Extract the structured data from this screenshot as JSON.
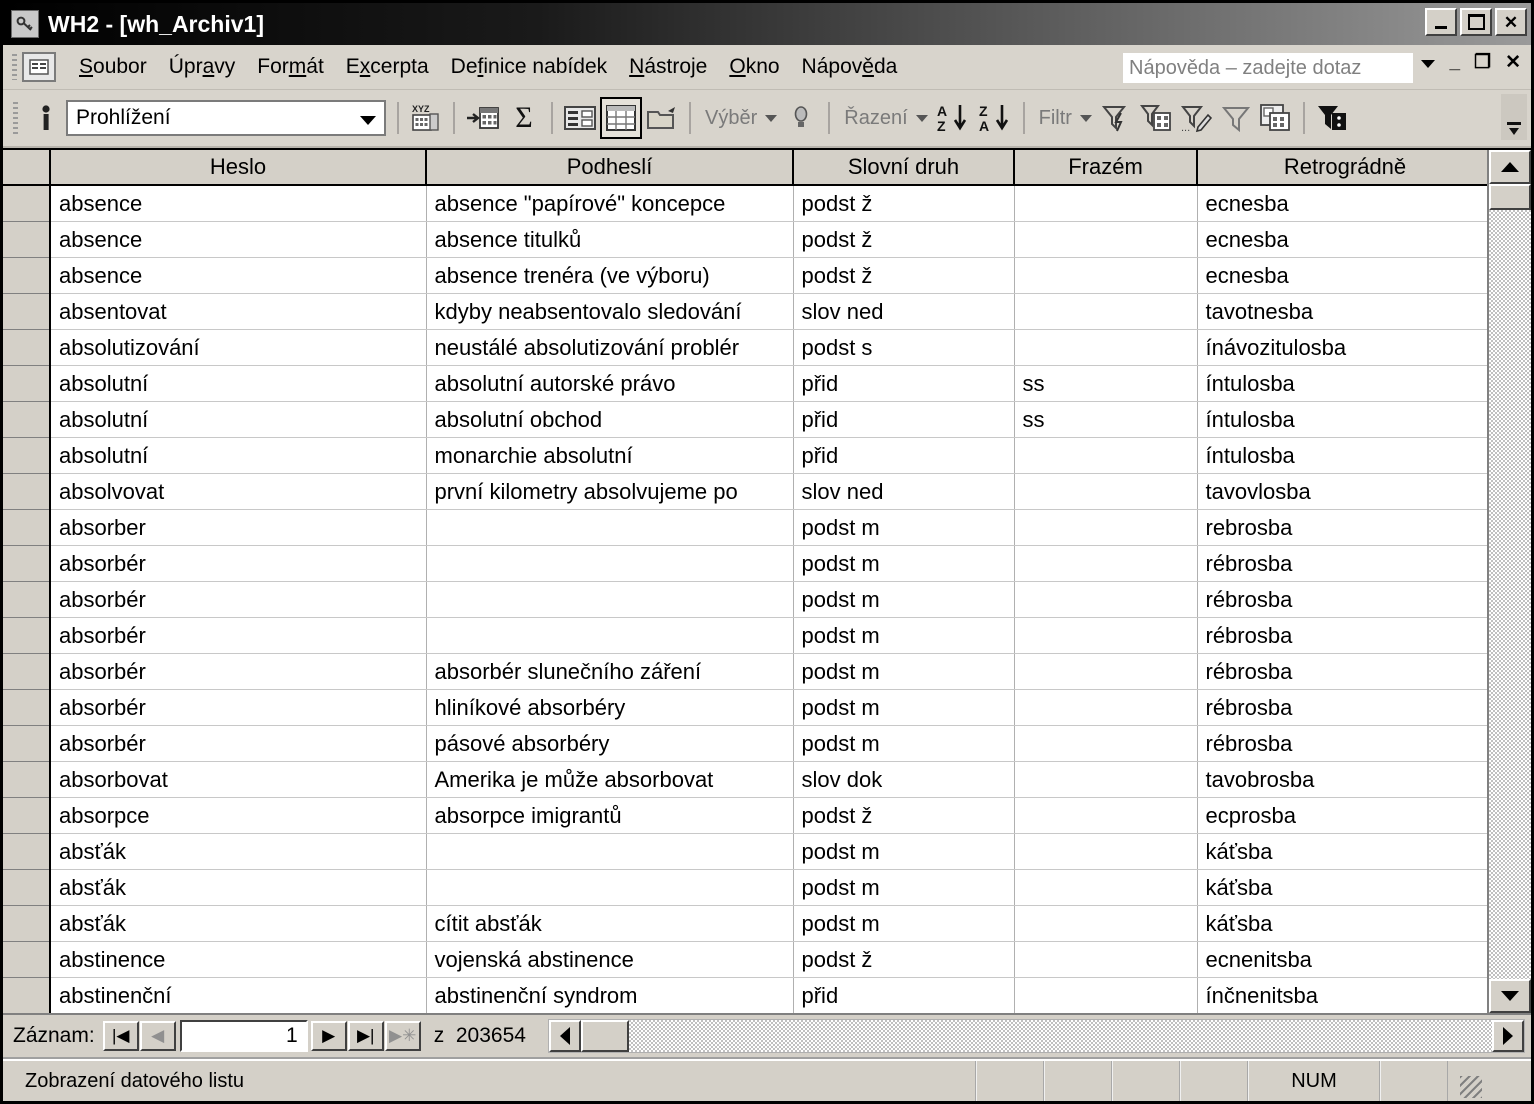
{
  "window": {
    "title": "WH2 - [wh_Archiv1]",
    "icon": "database-window-icon",
    "buttons": {
      "minimize": "_",
      "maximize": "□",
      "close": "✕"
    }
  },
  "menubar": {
    "app_icon": "access-object-icon",
    "items": [
      {
        "label": "Soubor",
        "accel": "S"
      },
      {
        "label": "Úpravy",
        "accel": "a"
      },
      {
        "label": "Formát",
        "accel": "m"
      },
      {
        "label": "Excerpta",
        "accel": "c"
      },
      {
        "label": "Definice nabídek",
        "accel": "f"
      },
      {
        "label": "Nástroje",
        "accel": "N"
      },
      {
        "label": "Okno",
        "accel": "O"
      },
      {
        "label": "Nápověda",
        "accel": "ě"
      }
    ],
    "help_box_placeholder": "Nápověda – zadejte dotaz",
    "mdi_buttons": {
      "minimize": "_",
      "restore": "❐",
      "close": "✕"
    }
  },
  "toolbar": {
    "view_combo_value": "Prohlížení",
    "buttons": [
      {
        "name": "view-person-icon",
        "label": ""
      },
      {
        "name": "spelling-icon",
        "label": "XYZ"
      },
      {
        "name": "new-record-icon",
        "label": ""
      },
      {
        "name": "totals-icon",
        "label": "Σ"
      },
      {
        "name": "form-view-icon",
        "label": ""
      },
      {
        "name": "datasheet-view-icon",
        "label": ""
      },
      {
        "name": "new-object-icon",
        "label": ""
      },
      {
        "name": "selection-label",
        "label": "Výběr"
      },
      {
        "name": "lightbulb-icon",
        "label": ""
      },
      {
        "name": "sort-label",
        "label": "Řazení"
      },
      {
        "name": "sort-ascending-icon",
        "label": "A Z"
      },
      {
        "name": "sort-descending-icon",
        "label": "Z A"
      },
      {
        "name": "filter-label",
        "label": "Filtr"
      },
      {
        "name": "apply-filter-icon",
        "label": ""
      },
      {
        "name": "filter-by-form-icon",
        "label": ""
      },
      {
        "name": "edit-filter-icon",
        "label": ""
      },
      {
        "name": "remove-filter-icon",
        "label": ""
      },
      {
        "name": "advanced-filter-icon",
        "label": ""
      },
      {
        "name": "filter-black-icon",
        "label": ""
      }
    ],
    "overflow_label": "toolbar-overflow-icon"
  },
  "datasheet": {
    "columns": [
      "Heslo",
      "Podheslí",
      "Slovní druh",
      "Frazém",
      "Retrográdně"
    ],
    "rows": [
      [
        "absence",
        "absence \"papírové\" koncepce",
        "podst ž",
        "",
        "ecnesba"
      ],
      [
        "absence",
        "absence titulků",
        "podst ž",
        "",
        "ecnesba"
      ],
      [
        "absence",
        "absence trenéra (ve výboru)",
        "podst ž",
        "",
        "ecnesba"
      ],
      [
        "absentovat",
        "kdyby neabsentovalo sledování",
        "slov ned",
        "",
        "tavotnesba"
      ],
      [
        "absolutizování",
        "neustálé absolutizování problér",
        "podst s",
        "",
        "ínávozitulosba"
      ],
      [
        "absolutní",
        "absolutní autorské právo",
        "přid",
        "ss",
        "íntulosba"
      ],
      [
        "absolutní",
        "absolutní obchod",
        "přid",
        "ss",
        "íntulosba"
      ],
      [
        "absolutní",
        "monarchie absolutní",
        "přid",
        "",
        "íntulosba"
      ],
      [
        "absolvovat",
        "první kilometry absolvujeme po",
        "slov ned",
        "",
        "tavovlosba"
      ],
      [
        "absorber",
        "",
        "podst m",
        "",
        "rebrosba"
      ],
      [
        "absorbér",
        "",
        "podst m",
        "",
        "rébrosba"
      ],
      [
        "absorbér",
        "",
        "podst m",
        "",
        "rébrosba"
      ],
      [
        "absorbér",
        "",
        "podst m",
        "",
        "rébrosba"
      ],
      [
        "absorbér",
        "absorbér slunečního záření",
        "podst m",
        "",
        "rébrosba"
      ],
      [
        "absorbér",
        "hliníkové absorbéry",
        "podst m",
        "",
        "rébrosba"
      ],
      [
        "absorbér",
        "pásové absorbéry",
        "podst m",
        "",
        "rébrosba"
      ],
      [
        "absorbovat",
        "Amerika je může absorbovat",
        "slov dok",
        "",
        "tavobrosba"
      ],
      [
        "absorpce",
        "absorpce imigrantů",
        "podst ž",
        "",
        "ecprosba"
      ],
      [
        "absťák",
        "",
        "podst m",
        "",
        "káťsba"
      ],
      [
        "absťák",
        "",
        "podst m",
        "",
        "káťsba"
      ],
      [
        "absťák",
        "cítit absťák",
        "podst m",
        "",
        "káťsba"
      ],
      [
        "abstinence",
        "vojenská abstinence",
        "podst ž",
        "",
        "ecnenitsba"
      ],
      [
        "abstinenční",
        "abstinenční syndrom",
        "přid",
        "",
        "ínčnenitsba"
      ]
    ]
  },
  "navbar": {
    "label": "Záznam:",
    "first_button": "|◀",
    "prev_button": "◀",
    "record_value": "1",
    "next_button": "▶",
    "last_button": "▶|",
    "new_button": "▶✳",
    "of_label": "z",
    "total_records": "203654"
  },
  "statusbar": {
    "message": "Zobrazení datového listu",
    "num_lock": "NUM"
  },
  "colors": {
    "window_face": "#d4d0c8",
    "titlebar_start": "#000000",
    "titlebar_end": "#9a9a9a",
    "grid_line": "#c8c8c8",
    "header_face": "#d4d0c8"
  }
}
